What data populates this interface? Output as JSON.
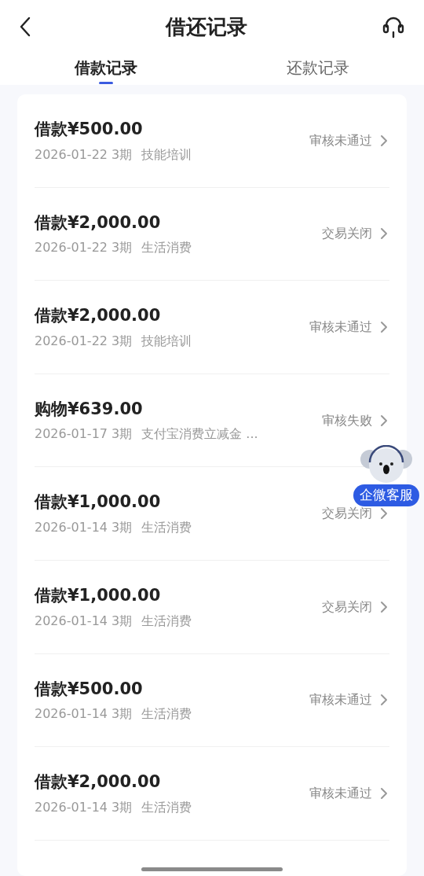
{
  "header": {
    "title": "借还记录"
  },
  "tabs": [
    {
      "label": "借款记录",
      "selected": true
    },
    {
      "label": "还款记录",
      "selected": false
    }
  ],
  "records": [
    {
      "title": "借款¥500.00",
      "meta": "2026-01-22 3期",
      "purpose": "技能培训",
      "status": "审核未通过"
    },
    {
      "title": "借款¥2,000.00",
      "meta": "2026-01-22 3期",
      "purpose": "生活消费",
      "status": "交易关闭"
    },
    {
      "title": "借款¥2,000.00",
      "meta": "2026-01-22 3期",
      "purpose": "技能培训",
      "status": "审核未通过"
    },
    {
      "title": "购物¥639.00",
      "meta": "2026-01-17 3期",
      "purpose": "支付宝消费立减金 ...",
      "status": "审核失败"
    },
    {
      "title": "借款¥1,000.00",
      "meta": "2026-01-14 3期",
      "purpose": "生活消费",
      "status": "交易关闭"
    },
    {
      "title": "借款¥1,000.00",
      "meta": "2026-01-14 3期",
      "purpose": "生活消费",
      "status": "交易关闭"
    },
    {
      "title": "借款¥500.00",
      "meta": "2026-01-14 3期",
      "purpose": "生活消费",
      "status": "审核未通过"
    },
    {
      "title": "借款¥2,000.00",
      "meta": "2026-01-14 3期",
      "purpose": "生活消费",
      "status": "审核未通过"
    }
  ],
  "support_widget": {
    "label": "企微客服"
  }
}
